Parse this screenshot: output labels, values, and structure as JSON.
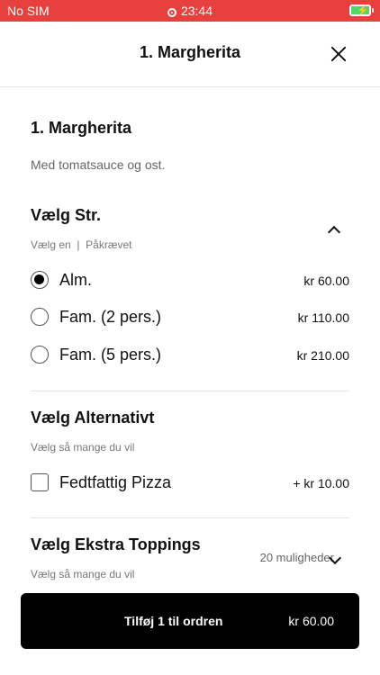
{
  "status_bar": {
    "carrier": "No SIM",
    "time": "23:44"
  },
  "header": {
    "title": "1. Margherita"
  },
  "item": {
    "title": "1. Margherita",
    "description": "Med tomatsauce og ost."
  },
  "size_section": {
    "title": "Vælg Str.",
    "meta": "Vælg en  |  Påkrævet",
    "options": [
      {
        "label": "Alm.",
        "price": "kr 60.00",
        "selected": true
      },
      {
        "label": "Fam. (2 pers.)",
        "price": "kr 110.00",
        "selected": false
      },
      {
        "label": "Fam. (5 pers.)",
        "price": "kr 210.00",
        "selected": false
      }
    ]
  },
  "alternative_section": {
    "title": "Vælg Alternativt",
    "meta": "Vælg så mange du vil",
    "options": [
      {
        "label": "Fedtfattig Pizza",
        "price": "+ kr 10.00",
        "checked": false
      }
    ]
  },
  "toppings_section": {
    "title": "Vælg Ekstra Toppings",
    "meta": "Vælg så mange du vil",
    "count": "20 muligheder"
  },
  "cta": {
    "label": "Tilføj 1 til ordren",
    "price": "kr 60.00"
  },
  "colors": {
    "status_bar": "#e8413d",
    "cta": "#000000",
    "battery": "#4cd964"
  }
}
